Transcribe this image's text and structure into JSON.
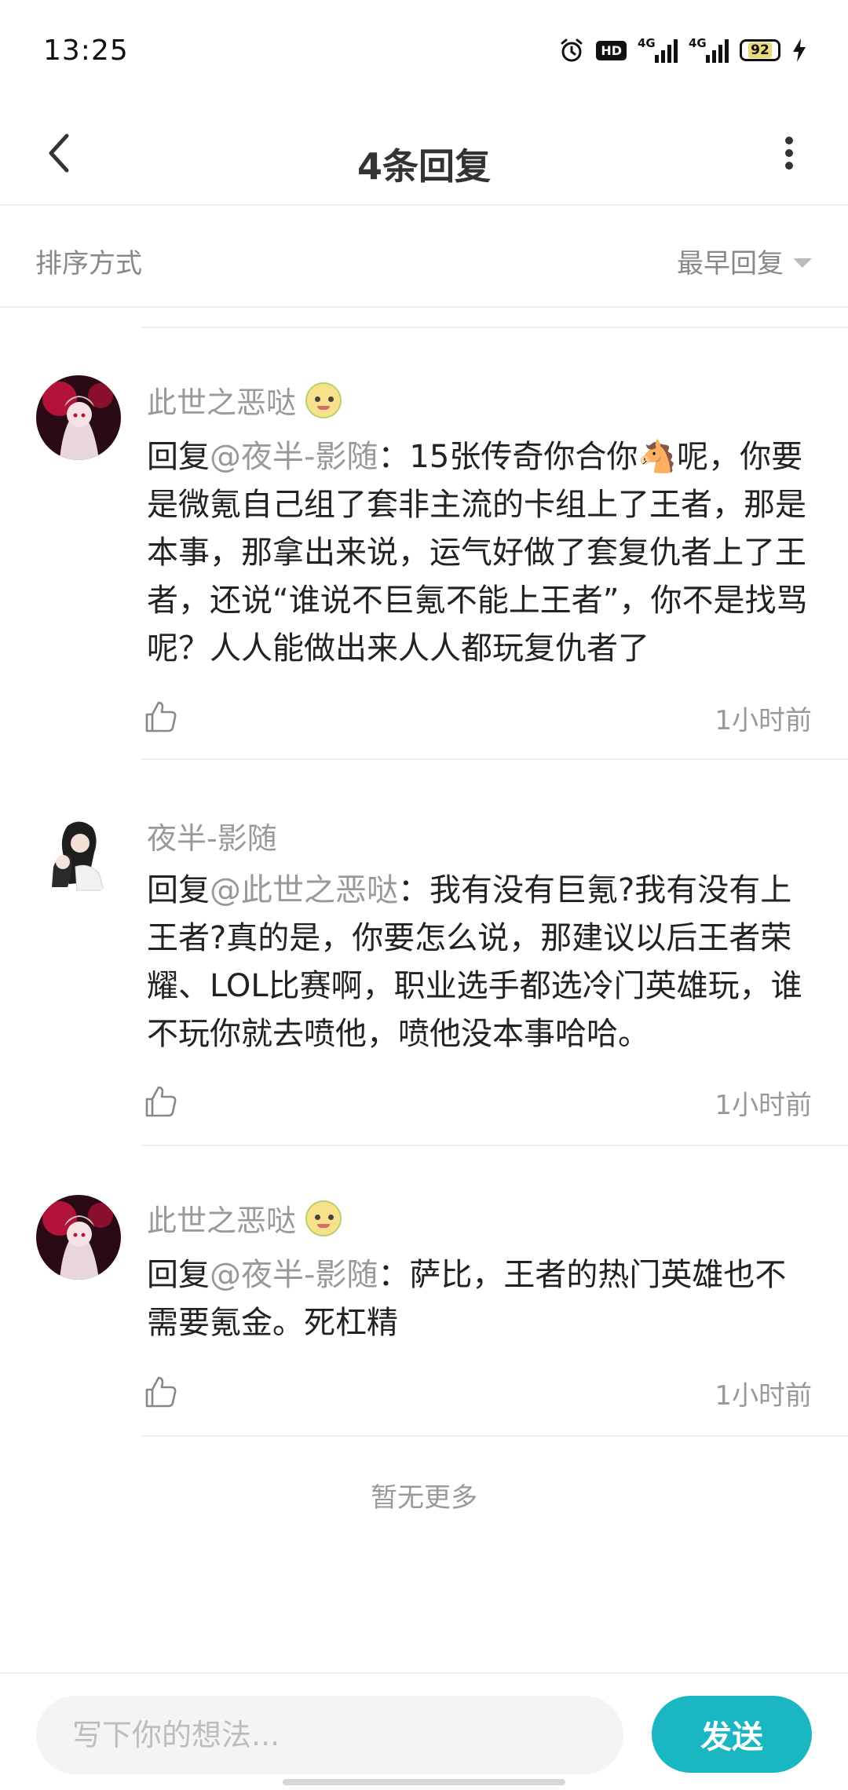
{
  "status_bar": {
    "time": "13:25",
    "hd_label": "HD",
    "signal1_label": "4G",
    "signal2_label": "4G",
    "battery": "92",
    "icons": [
      "alarm-icon",
      "hd-icon",
      "signal-icon",
      "signal-icon",
      "battery-icon",
      "charging-icon"
    ]
  },
  "header": {
    "title": "4条回复",
    "back_icon": "chevron-left-icon",
    "more_icon": "more-vertical-icon"
  },
  "sort": {
    "label": "排序方式",
    "selected": "最早回复"
  },
  "comments": [
    {
      "user": "此世之恶哒",
      "has_badge": true,
      "prefix": "回复",
      "mention": "@夜半-影随",
      "text": "：15张传奇你合你🐴呢，你要是微氪自己组了套非主流的卡组上了王者，那是本事，那拿出来说，运气好做了套复仇者上了王者，还说“谁说不巨氪不能上王者”，你不是找骂呢？人人能做出来人人都玩复仇者了",
      "time": "1小时前"
    },
    {
      "user": "夜半-影随",
      "has_badge": false,
      "prefix": "回复",
      "mention": "@此世之恶哒",
      "text": "：我有没有巨氪?我有没有上王者?真的是，你要怎么说，那建议以后王者荣耀、LOL比赛啊，职业选手都选冷门英雄玩，谁不玩你就去喷他，喷他没本事哈哈。",
      "time": "1小时前"
    },
    {
      "user": "此世之恶哒",
      "has_badge": true,
      "prefix": "回复",
      "mention": "@夜半-影随",
      "text": "：萨比，王者的热门英雄也不需要氪金。死杠精",
      "time": "1小时前"
    }
  ],
  "footer_note": "暂无更多",
  "input": {
    "placeholder": "写下你的想法...",
    "send_label": "发送"
  },
  "colors": {
    "accent": "#1ab7c3",
    "muted_text": "#999999",
    "divider": "#ececec"
  }
}
